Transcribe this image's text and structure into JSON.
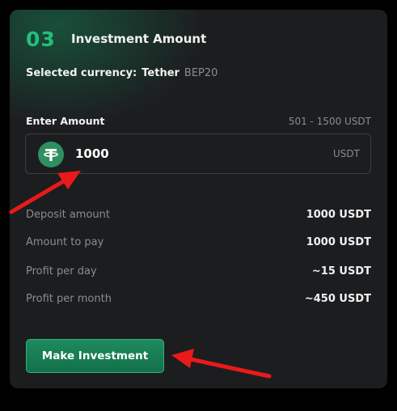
{
  "step": {
    "number": "03",
    "title": "Investment Amount"
  },
  "currency": {
    "label": "Selected currency:",
    "name": "Tether",
    "network": "BEP20"
  },
  "amount_input": {
    "label": "Enter Amount",
    "range": "501 - 1500 USDT",
    "value": "1000",
    "unit": "USDT",
    "token_icon": "tether-icon"
  },
  "summary": [
    {
      "label": "Deposit amount",
      "value": "1000 USDT"
    },
    {
      "label": "Amount to pay",
      "value": "1000 USDT"
    },
    {
      "label": "Profit per day",
      "value": "~15 USDT"
    },
    {
      "label": "Profit per month",
      "value": "~450 USDT"
    }
  ],
  "button": {
    "label": "Make Investment"
  },
  "colors": {
    "accent": "#21c07a",
    "card_background": "#1c1d1f",
    "button": "#1e8a5d",
    "annotation_arrow": "#e81a1a"
  }
}
